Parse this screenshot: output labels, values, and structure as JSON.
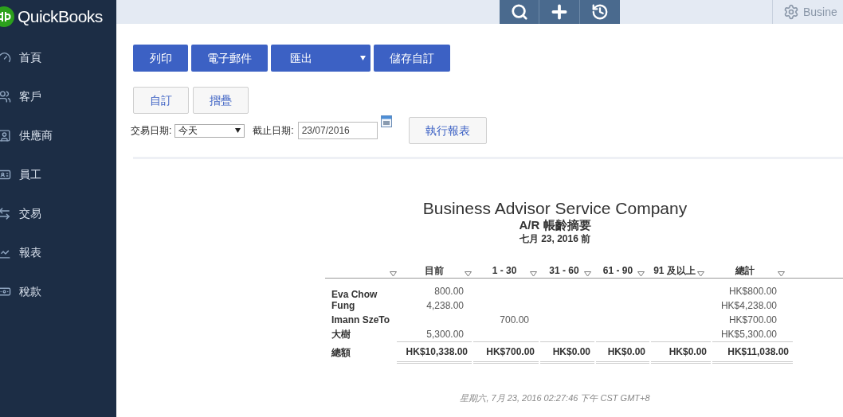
{
  "brand": {
    "name": "QuickBooks"
  },
  "sidebar": {
    "items": [
      {
        "label": "首頁",
        "kind": "dashboard",
        "selected": false
      },
      {
        "label": "客戶",
        "kind": "customers",
        "selected": false
      },
      {
        "label": "供應商",
        "kind": "vendors",
        "selected": false
      },
      {
        "label": "員工",
        "kind": "employees",
        "selected": false
      },
      {
        "label": "交易",
        "kind": "transactions",
        "selected": false
      },
      {
        "label": "報表",
        "kind": "reports",
        "selected": false
      },
      {
        "label": "稅款",
        "kind": "taxes",
        "selected": false
      }
    ]
  },
  "top_bar": {
    "company": "Busine"
  },
  "toolbar": {
    "buttons": [
      {
        "label": "列印",
        "dropdown": false
      },
      {
        "label": "電子郵件",
        "dropdown": false
      },
      {
        "label": "匯出",
        "dropdown": true
      },
      {
        "label": "儲存自訂",
        "dropdown": false
      }
    ],
    "secondary_buttons": [
      "自訂",
      "摺疊"
    ]
  },
  "filters": {
    "date_label": "交易日期:",
    "date_value": "今天",
    "end_label": "截止日期:",
    "end_value": "23/07/2016",
    "run_button": "執行報表"
  },
  "report": {
    "company": "Business Advisor Service Company",
    "title": "A/R 帳齡摘要",
    "subtitle": "七月 23, 2016 前",
    "columns": [
      "目前",
      "1 - 30",
      "31 - 60",
      "61 - 90",
      "91 及以上",
      "總計"
    ],
    "rows": [
      {
        "name": "Eva Chow",
        "cells": [
          "800.00",
          "",
          "",
          "",
          "",
          "HK$800.00"
        ]
      },
      {
        "name": "Fung",
        "cells": [
          "4,238.00",
          "",
          "",
          "",
          "",
          "HK$4,238.00"
        ]
      },
      {
        "name": "Imann SzeTo",
        "cells": [
          "",
          "700.00",
          "",
          "",
          "",
          "HK$700.00"
        ]
      },
      {
        "name": "大樹",
        "cells": [
          "5,300.00",
          "",
          "",
          "",
          "",
          "HK$5,300.00"
        ]
      }
    ],
    "total": {
      "name": "總額",
      "cells": [
        "HK$10,338.00",
        "HK$700.00",
        "HK$0.00",
        "HK$0.00",
        "HK$0.00",
        "HK$11,038.00"
      ]
    },
    "footer": "星期六, 7月 23, 2016 02:27:46 下午 CST GMT+8"
  }
}
